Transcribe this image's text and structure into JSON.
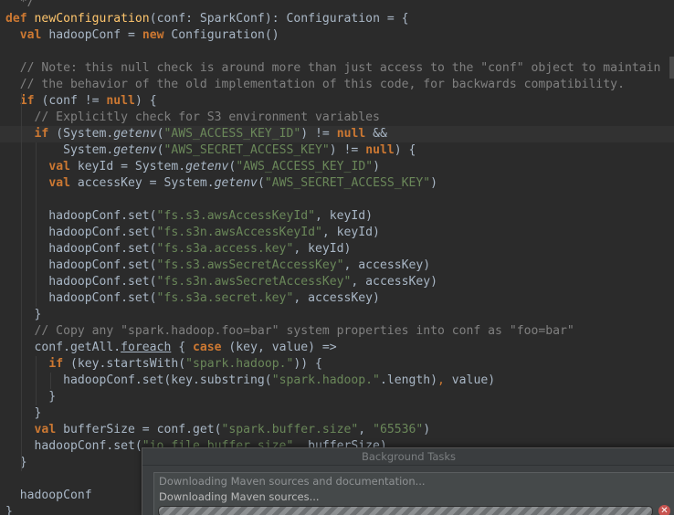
{
  "editor": {
    "language": "Scala",
    "lines": [
      {
        "tokens": [
          {
            "t": "  */",
            "c": "cmt"
          }
        ]
      },
      {
        "tokens": [
          {
            "t": "def",
            "c": "kw"
          },
          {
            "t": " "
          },
          {
            "t": "newConfiguration",
            "c": "fn"
          },
          {
            "t": "(conf: SparkConf): Configuration = {"
          }
        ]
      },
      {
        "tokens": [
          {
            "t": "  "
          },
          {
            "t": "val",
            "c": "kw"
          },
          {
            "t": " hadoopConf = "
          },
          {
            "t": "new",
            "c": "kw"
          },
          {
            "t": " Configuration()"
          }
        ]
      },
      {
        "tokens": [
          {
            "t": ""
          }
        ]
      },
      {
        "tokens": [
          {
            "t": "  // Note: this null check is around more than just access to the \"conf\" object to maintain",
            "c": "cmt"
          }
        ]
      },
      {
        "tokens": [
          {
            "t": "  // the behavior of the old implementation of this code, for backwards compatibility.",
            "c": "cmt"
          }
        ]
      },
      {
        "tokens": [
          {
            "t": "  "
          },
          {
            "t": "if",
            "c": "kw"
          },
          {
            "t": " (conf != "
          },
          {
            "t": "null",
            "c": "kw"
          },
          {
            "t": ") {"
          }
        ]
      },
      {
        "tokens": [
          {
            "t": "    // Explicitly check for S3 environment variables",
            "c": "cmt"
          }
        ]
      },
      {
        "current": true,
        "tokens": [
          {
            "t": "    "
          },
          {
            "t": "if",
            "c": "kw"
          },
          {
            "t": " (System."
          },
          {
            "t": "getenv",
            "c": "it"
          },
          {
            "t": "("
          },
          {
            "t": "\"AWS_ACCESS_KEY_ID\"",
            "c": "str"
          },
          {
            "t": ") != "
          },
          {
            "t": "null",
            "c": "kw"
          },
          {
            "t": " &&"
          }
        ]
      },
      {
        "tokens": [
          {
            "t": "        System."
          },
          {
            "t": "getenv",
            "c": "it"
          },
          {
            "t": "("
          },
          {
            "t": "\"AWS_SECRET_ACCESS_KEY\"",
            "c": "str"
          },
          {
            "t": ") != "
          },
          {
            "t": "null",
            "c": "kw"
          },
          {
            "t": ") {"
          }
        ]
      },
      {
        "tokens": [
          {
            "t": "      "
          },
          {
            "t": "val",
            "c": "kw"
          },
          {
            "t": " keyId = System."
          },
          {
            "t": "getenv",
            "c": "it"
          },
          {
            "t": "("
          },
          {
            "t": "\"AWS_ACCESS_KEY_ID\"",
            "c": "str"
          },
          {
            "t": ")"
          }
        ]
      },
      {
        "tokens": [
          {
            "t": "      "
          },
          {
            "t": "val",
            "c": "kw"
          },
          {
            "t": " accessKey = System."
          },
          {
            "t": "getenv",
            "c": "it"
          },
          {
            "t": "("
          },
          {
            "t": "\"AWS_SECRET_ACCESS_KEY\"",
            "c": "str"
          },
          {
            "t": ")"
          }
        ]
      },
      {
        "tokens": [
          {
            "t": ""
          }
        ]
      },
      {
        "tokens": [
          {
            "t": "      hadoopConf.set("
          },
          {
            "t": "\"fs.s3.awsAccessKeyId\"",
            "c": "str"
          },
          {
            "t": ", keyId)"
          }
        ]
      },
      {
        "tokens": [
          {
            "t": "      hadoopConf.set("
          },
          {
            "t": "\"fs.s3n.awsAccessKeyId\"",
            "c": "str"
          },
          {
            "t": ", keyId)"
          }
        ]
      },
      {
        "tokens": [
          {
            "t": "      hadoopConf.set("
          },
          {
            "t": "\"fs.s3a.access.key\"",
            "c": "str"
          },
          {
            "t": ", keyId)"
          }
        ]
      },
      {
        "tokens": [
          {
            "t": "      hadoopConf.set("
          },
          {
            "t": "\"fs.s3.awsSecretAccessKey\"",
            "c": "str"
          },
          {
            "t": ", accessKey)"
          }
        ]
      },
      {
        "tokens": [
          {
            "t": "      hadoopConf.set("
          },
          {
            "t": "\"fs.s3n.awsSecretAccessKey\"",
            "c": "str"
          },
          {
            "t": ", accessKey)"
          }
        ]
      },
      {
        "tokens": [
          {
            "t": "      hadoopConf.set("
          },
          {
            "t": "\"fs.s3a.secret.key\"",
            "c": "str"
          },
          {
            "t": ", accessKey)"
          }
        ]
      },
      {
        "tokens": [
          {
            "t": "    }"
          }
        ]
      },
      {
        "tokens": [
          {
            "t": "    // Copy any \"spark.hadoop.foo=bar\" system properties into conf as \"foo=bar\"",
            "c": "cmt"
          }
        ]
      },
      {
        "tokens": [
          {
            "t": "    conf.getAll."
          },
          {
            "t": "foreach",
            "c": "ul"
          },
          {
            "t": " { "
          },
          {
            "t": "case",
            "c": "kw"
          },
          {
            "t": " (key, value) =>"
          }
        ]
      },
      {
        "tokens": [
          {
            "t": "      "
          },
          {
            "t": "if",
            "c": "kw"
          },
          {
            "t": " (key.startsWith("
          },
          {
            "t": "\"spark.hadoop.\"",
            "c": "str"
          },
          {
            "t": ")) {"
          }
        ]
      },
      {
        "tokens": [
          {
            "t": "        hadoopConf.set(key.substring("
          },
          {
            "t": "\"spark.hadoop.\"",
            "c": "str"
          },
          {
            "t": ".length)"
          },
          {
            "t": ",",
            "c": "op"
          },
          {
            "t": " value)"
          }
        ]
      },
      {
        "tokens": [
          {
            "t": "      }"
          }
        ]
      },
      {
        "tokens": [
          {
            "t": "    }"
          }
        ]
      },
      {
        "tokens": [
          {
            "t": "    "
          },
          {
            "t": "val",
            "c": "kw"
          },
          {
            "t": " bufferSize = conf.get("
          },
          {
            "t": "\"spark.buffer.size\"",
            "c": "str"
          },
          {
            "t": ", "
          },
          {
            "t": "\"65536\"",
            "c": "str"
          },
          {
            "t": ")"
          }
        ]
      },
      {
        "tokens": [
          {
            "t": "    hadoopConf.set("
          },
          {
            "t": "\"io.file.buffer.size\"",
            "c": "str"
          },
          {
            "t": ", bufferSize)"
          }
        ]
      },
      {
        "tokens": [
          {
            "t": "  }"
          }
        ]
      },
      {
        "tokens": [
          {
            "t": ""
          }
        ]
      },
      {
        "tokens": [
          {
            "t": "  hadoopConf"
          }
        ]
      },
      {
        "tokens": [
          {
            "t": "}"
          }
        ]
      }
    ]
  },
  "background_tasks": {
    "title": "Background Tasks",
    "primary_task": "Downloading Maven sources and documentation...",
    "secondary_task": "Downloading Maven sources...",
    "progress_state": "indeterminate",
    "cancel_icon": "close-icon",
    "colors": {
      "cancel": "#c75450",
      "panel": "#3c3f41"
    }
  },
  "theme": {
    "name": "Darcula",
    "background": "#2b2b2b",
    "keyword": "#cc7832",
    "string": "#6a8759",
    "comment": "#808080",
    "function": "#ffc66d",
    "text": "#a9b7c6"
  }
}
